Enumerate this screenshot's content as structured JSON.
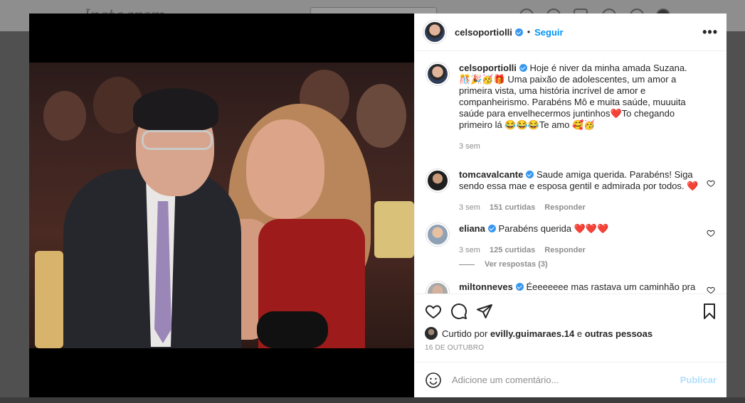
{
  "background": {
    "logo": "Instagram"
  },
  "post": {
    "author": "celsoportiolli",
    "follow_label": "Seguir",
    "dot": "•",
    "more": "•••"
  },
  "caption": {
    "author": "celsoportiolli",
    "text": "Hoje é niver da minha amada Suzana. 🎊🎉🥳🎁 Uma paixão de adolescentes, um amor a primeira vista, uma história incrível de amor e companheirismo. Parabéns Mô e muita saúde, muuuita saúde para envelhecermos juntinhos❤️To chegando primeiro lá 😂😂😂Te amo 🥰🥳",
    "time": "3 sem"
  },
  "comments": [
    {
      "user": "tomcavalcante",
      "text": "Saude amiga querida. Parabéns! Siga sendo essa mae e esposa gentil e admirada por todos. ❤️",
      "time": "3 sem",
      "likes": "151 curtidas",
      "reply": "Responder"
    },
    {
      "user": "eliana",
      "text": "Parabéns querida ❤️❤️❤️",
      "time": "3 sem",
      "likes": "125 curtidas",
      "reply": "Responder",
      "view_replies": "Ver respostas (3)"
    },
    {
      "user": "miltonneves",
      "text": "Éeeeeeee mas rastava um caminhão pra"
    }
  ],
  "likes": {
    "prefix": "Curtido por",
    "user": "evilly.guimaraes.14",
    "conj": "e",
    "others": "outras pessoas"
  },
  "date": "16 DE OUTUBRO",
  "add_comment": {
    "placeholder": "Adicione um comentário...",
    "publish": "Publicar"
  },
  "colors": {
    "accent": "#0095f6",
    "verified": "#3897f0",
    "publish_disabled": "#b2dffc"
  }
}
